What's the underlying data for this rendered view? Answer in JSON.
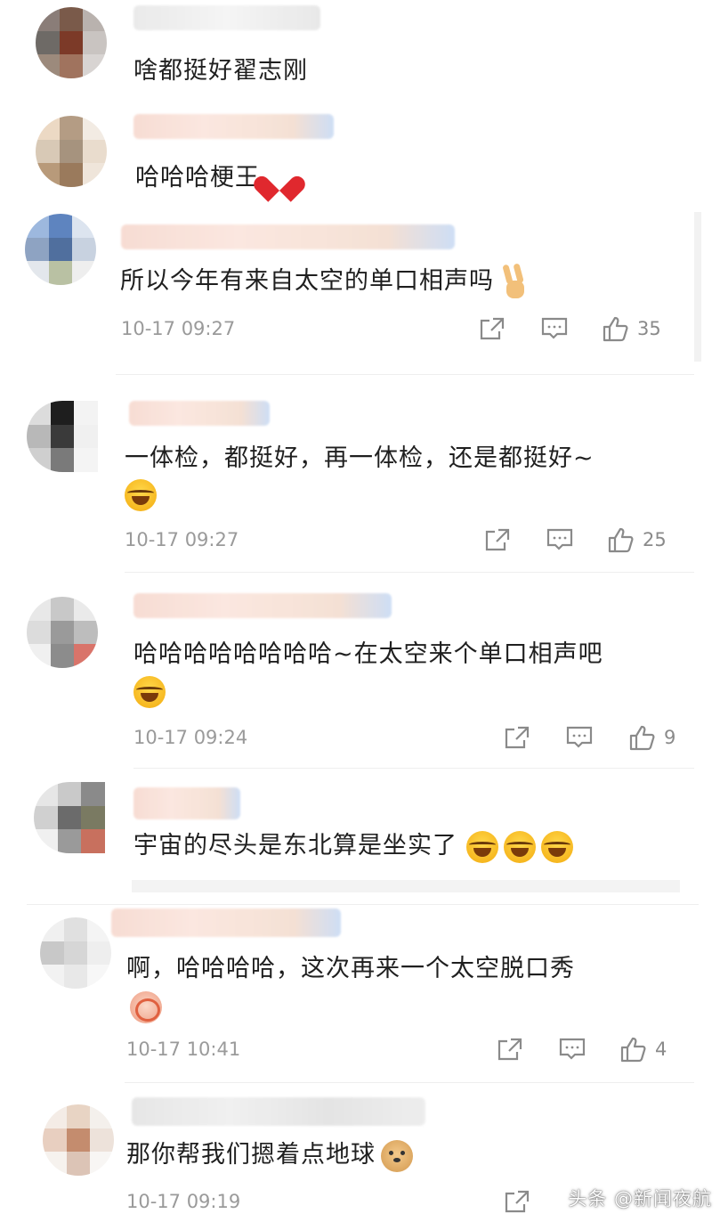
{
  "comments": [
    {
      "text": "啥都挺好翟志刚",
      "emoji": [],
      "time": "",
      "likes": ""
    },
    {
      "text": "哈哈哈梗王",
      "emoji": [
        "heart-icon"
      ],
      "time": "",
      "likes": ""
    },
    {
      "text": "所以今年有来自太空的单口相声吗",
      "emoji": [
        "victory-hand-icon"
      ],
      "time": "10-17 09:27",
      "likes": "35"
    },
    {
      "text": "一体检，都挺好，再一体检，还是都挺好~",
      "emoji": [
        "tears-of-joy-icon"
      ],
      "time": "10-17 09:27",
      "likes": "25"
    },
    {
      "text": "哈哈哈哈哈哈哈哈~在太空来个单口相声吧",
      "emoji": [
        "tears-of-joy-icon"
      ],
      "time": "10-17 09:24",
      "likes": "9"
    },
    {
      "text": "宇宙的尽头是东北算是坐实了",
      "emoji": [
        "tears-of-joy-icon",
        "tears-of-joy-icon",
        "tears-of-joy-icon"
      ],
      "time": "",
      "likes": ""
    },
    {
      "text": "啊，哈哈哈哈，这次再来一个太空脱口秀",
      "emoji": [
        "ok-hand-icon"
      ],
      "time": "10-17 10:41",
      "likes": "4"
    },
    {
      "text": "那你帮我们摁着点地球",
      "emoji": [
        "doge-icon"
      ],
      "time": "10-17 09:19",
      "likes": ""
    }
  ],
  "watermark": "头条 @新闻夜航",
  "colors": {
    "text": "#1f1f1f",
    "meta": "#9a9a9a",
    "icon": "#8a8a8a",
    "heart": "#e0282e",
    "emoji": "#f6b61e"
  }
}
